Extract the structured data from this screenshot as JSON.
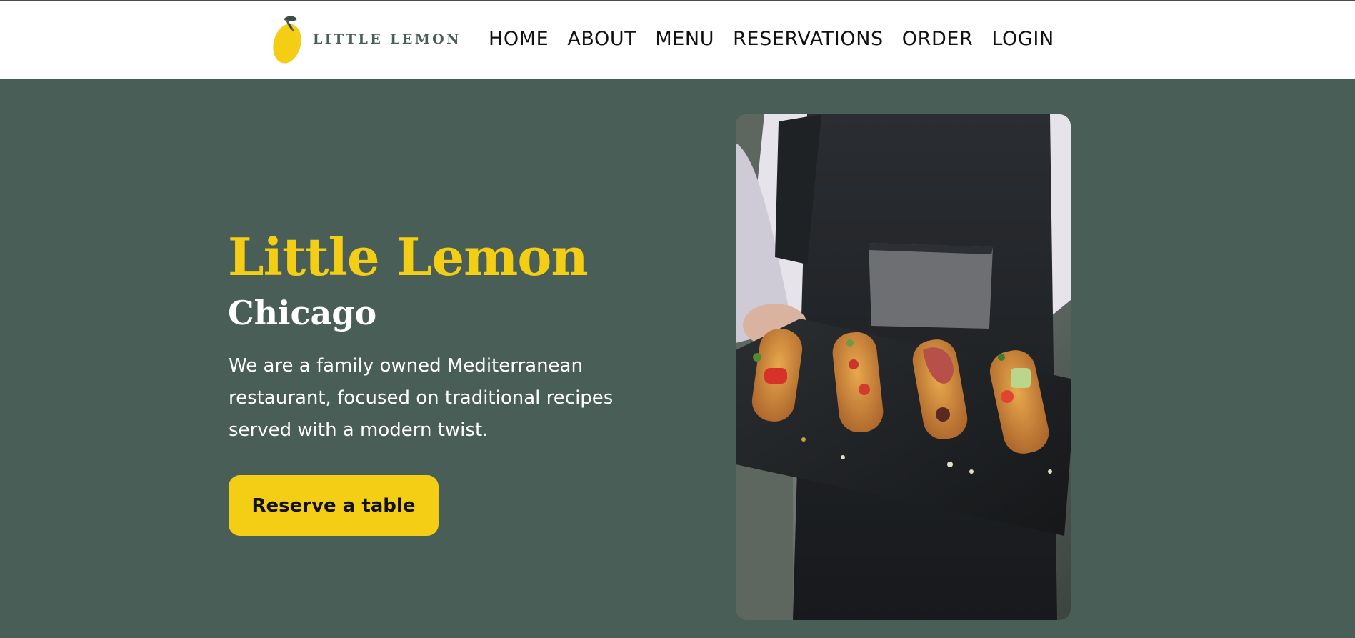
{
  "brand": {
    "name": "LITTLE LEMON",
    "logo_icon": "lemon-icon",
    "colors": {
      "primary_green": "#495e57",
      "primary_yellow": "#f4ce14"
    }
  },
  "nav": {
    "items": [
      {
        "label": "HOME"
      },
      {
        "label": "ABOUT"
      },
      {
        "label": "MENU"
      },
      {
        "label": "RESERVATIONS"
      },
      {
        "label": "ORDER"
      },
      {
        "label": "LOGIN"
      }
    ]
  },
  "hero": {
    "title": "Little Lemon",
    "subtitle": "Chicago",
    "description": "We are a family owned Mediterranean restaurant, focused on traditional recipes served with a modern twist.",
    "cta_label": "Reserve a table",
    "image": "chef holding slate tray with bruschetta"
  }
}
